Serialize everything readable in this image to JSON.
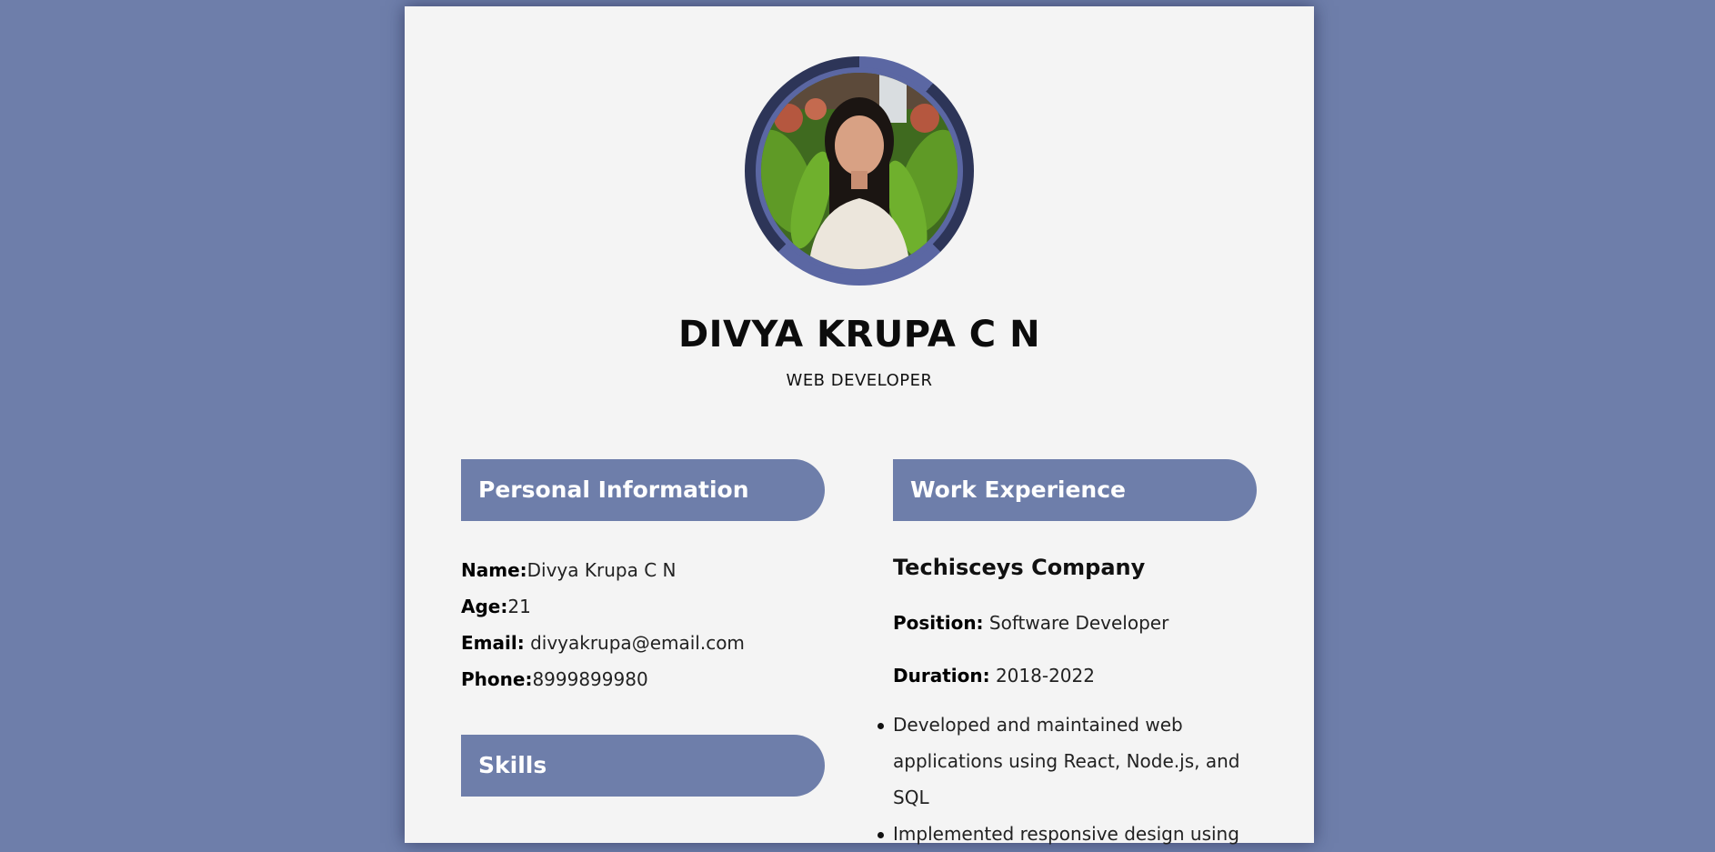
{
  "profile": {
    "name": "DIVYA KRUPA C N",
    "role": "WEB DEVELOPER",
    "photo_alt": "profile-photo"
  },
  "colors": {
    "background": "#6e7eaa",
    "card": "#f4f4f4",
    "ring_dark": "#2d3558",
    "ring_light": "#5b67a3"
  },
  "personal": {
    "heading": "Personal Information",
    "name_label": "Name:",
    "name_value": "Divya Krupa C N",
    "age_label": "Age:",
    "age_value": "21",
    "email_label": "Email:",
    "email_value": " divyakrupa@email.com",
    "phone_label": "Phone:",
    "phone_value": "8999899980"
  },
  "skills": {
    "heading": "Skills"
  },
  "work": {
    "heading": "Work Experience",
    "company": "Techisceys Company",
    "position_label": "Position:",
    "position_value": " Software Developer",
    "duration_label": "Duration:",
    "duration_value": " 2018-2022",
    "bullets": [
      "Developed and maintained web applications using React, Node.js, and SQL",
      "Implemented responsive design using"
    ]
  }
}
